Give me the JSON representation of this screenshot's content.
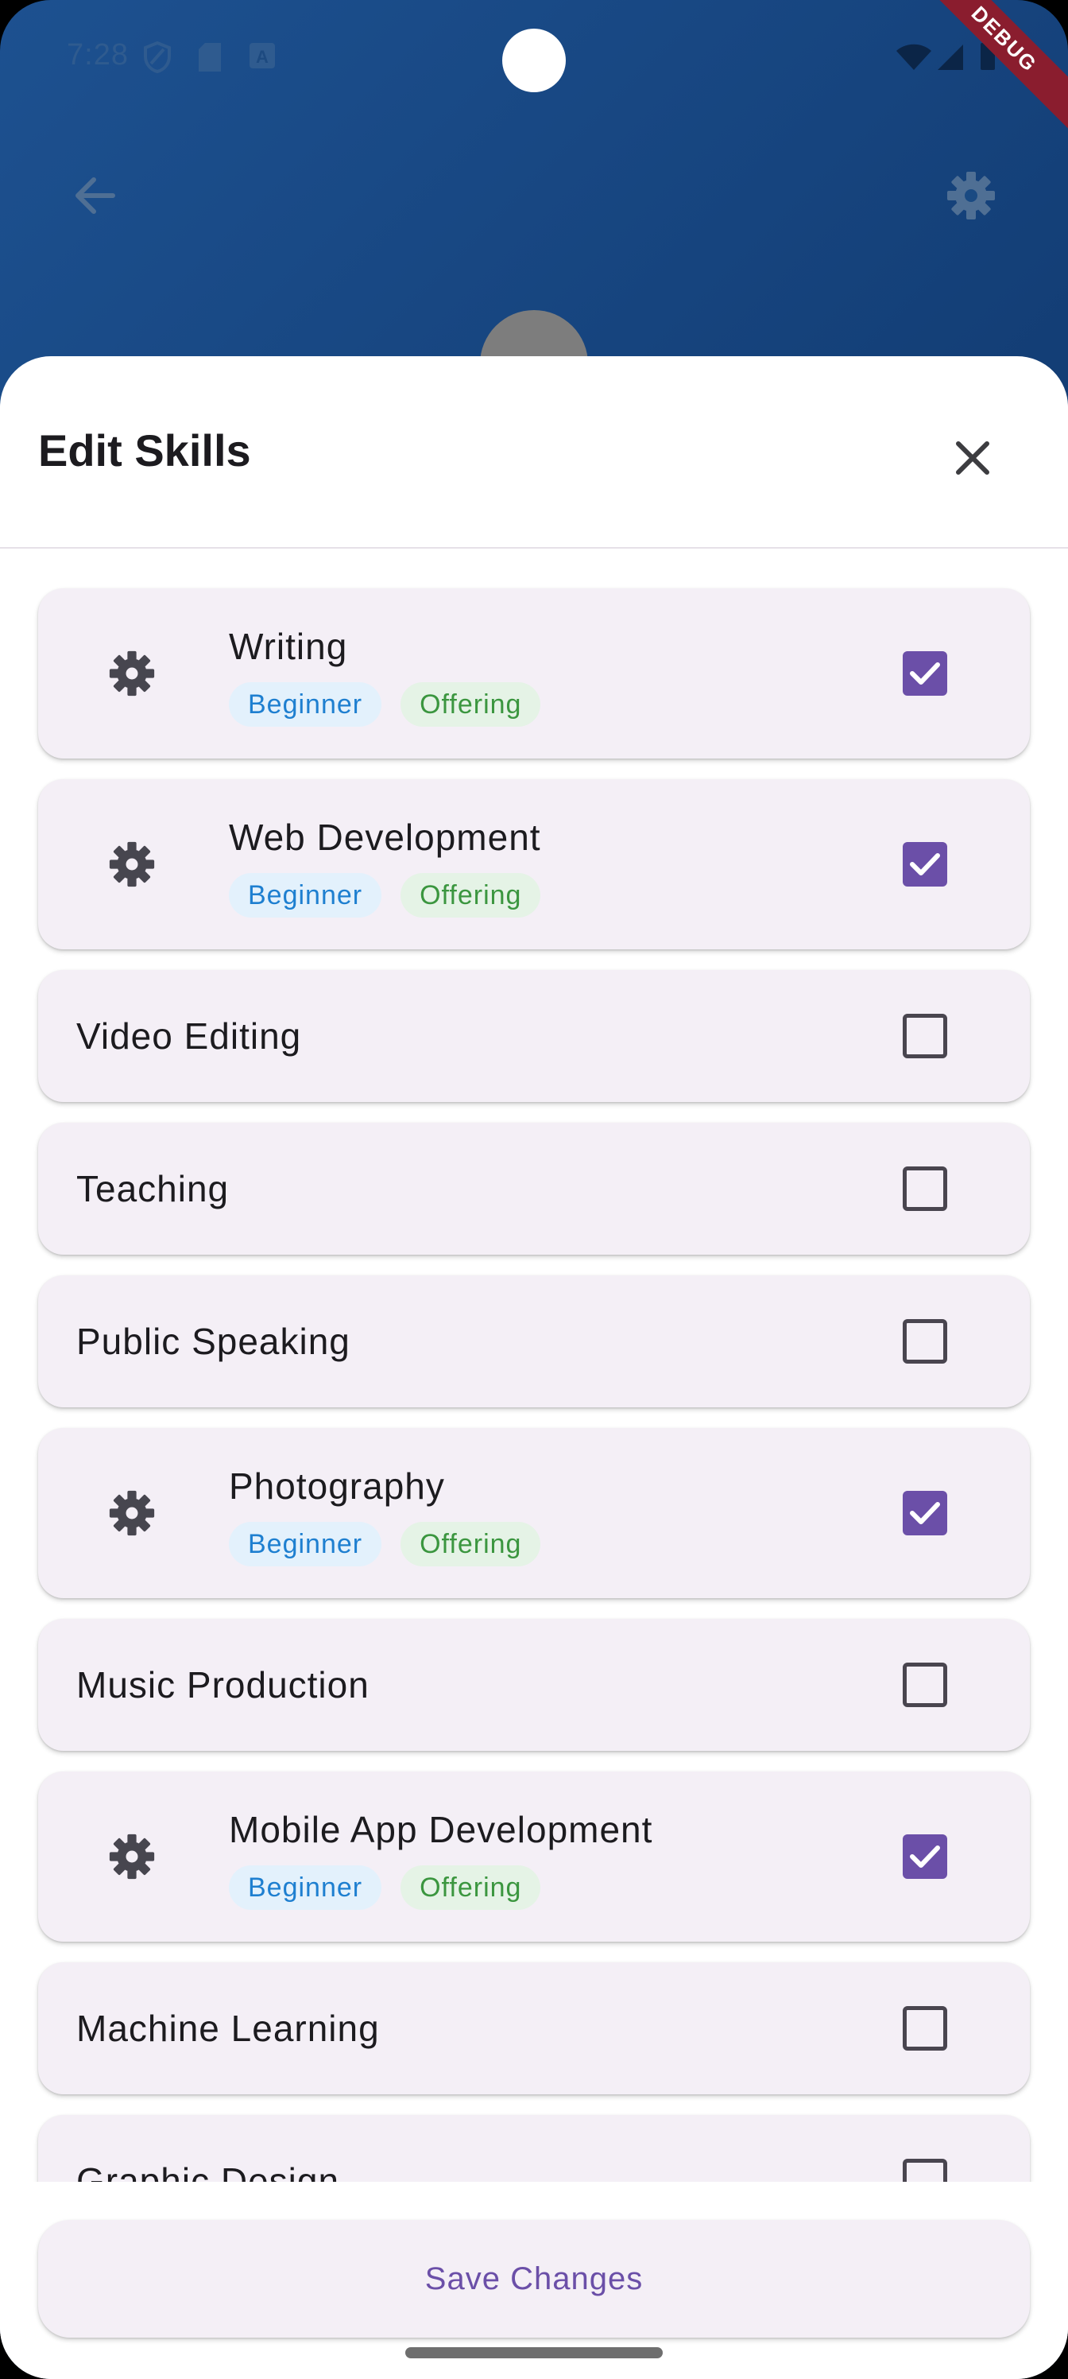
{
  "status_bar": {
    "time": "7:28",
    "debug_label": "DEBUG",
    "icons": [
      "shield-icon",
      "sd-card-icon",
      "a-badge-icon",
      "wifi-icon",
      "signal-icon",
      "battery-icon"
    ]
  },
  "app_bar": {
    "back_icon": "arrow-back-icon",
    "settings_icon": "gear-icon"
  },
  "sheet": {
    "title": "Edit Skills",
    "close_icon": "close-icon"
  },
  "skills": [
    {
      "name": "Writing",
      "checked": true,
      "level": "Beginner",
      "mode": "Offering"
    },
    {
      "name": "Web Development",
      "checked": true,
      "level": "Beginner",
      "mode": "Offering"
    },
    {
      "name": "Video Editing",
      "checked": false
    },
    {
      "name": "Teaching",
      "checked": false
    },
    {
      "name": "Public Speaking",
      "checked": false
    },
    {
      "name": "Photography",
      "checked": true,
      "level": "Beginner",
      "mode": "Offering"
    },
    {
      "name": "Music Production",
      "checked": false
    },
    {
      "name": "Mobile App Development",
      "checked": true,
      "level": "Beginner",
      "mode": "Offering"
    },
    {
      "name": "Machine Learning",
      "checked": false
    },
    {
      "name": "Graphic Design",
      "checked": false
    }
  ],
  "footer": {
    "save_label": "Save Changes"
  },
  "colors": {
    "header_gradient": "#1d5190",
    "accent": "#6b4fa8",
    "card_bg": "#f4eff6",
    "level_tag_bg": "#e3f1fc",
    "level_tag_text": "#1e7fd0",
    "mode_tag_bg": "#e5f3e6",
    "mode_tag_text": "#3b963f"
  }
}
